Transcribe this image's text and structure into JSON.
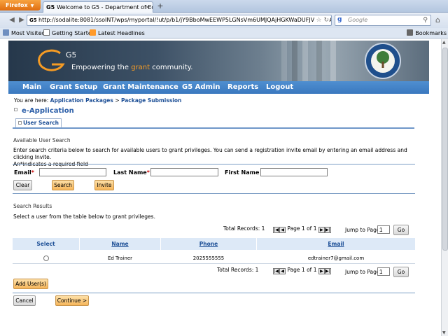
{
  "browser": {
    "app_button": "Firefox",
    "tab_title": "Welcome to G5 - Department of Educati...",
    "tab_favicon": "G5",
    "url": "http://sodalite:8081/ssoINT/wps/myportal/!ut/p/b1/jY9BboMwEEWP5LGNsVm6UMJQAjHGKWaDUFJVQSTpAkVK1",
    "search_placeholder": "Google",
    "bookmarks": {
      "most_visited": "Most Visited",
      "getting_started": "Getting Started",
      "latest_headlines": "Latest Headlines",
      "bookmarks": "Bookmarks"
    }
  },
  "banner": {
    "logo": "G5",
    "tagline_pre": "Empowering the ",
    "tagline_accent": "grant",
    "tagline_post": " community.",
    "accent_color": "#f59b24"
  },
  "menu": {
    "items": [
      "Main",
      "Grant Setup",
      "Grant Maintenance",
      "G5 Admin",
      "Reports",
      "Logout"
    ]
  },
  "breadcrumb": {
    "prefix": "You are here: ",
    "item1": "Application Packages",
    "sep": " > ",
    "item2": "Package Submission"
  },
  "app_title": "e-Application",
  "subtab": "User Search",
  "search": {
    "section_title": "Available User Search",
    "instructions_1": "Enter search criteria below to search for available users to grant privileges. You can send a registration invite email by entering an email address and clicking Invite.",
    "instructions_2": "An*indicates a required field",
    "email_label": "Email",
    "last_name_label": "Last Name",
    "first_name_label": "First Name",
    "required_mark": "*",
    "email_value": "",
    "last_name_value": "",
    "first_name_value": "",
    "clear_label": "Clear",
    "search_label": "Search",
    "invite_label": "Invite"
  },
  "results": {
    "section_title": "Search Results",
    "instructions": "Select a user from the table below to grant privileges.",
    "total_label": "Total Records: ",
    "total": "1",
    "page_text": "Page 1 of 1",
    "jump_label": "Jump to Page",
    "jump_value": "1",
    "go_label": "Go",
    "columns": [
      "Select",
      "Name",
      "Phone",
      "Email"
    ],
    "rows": [
      {
        "name": "Ed Trainer",
        "phone": "2025555555",
        "email": "edtrainer7@gmail.com"
      }
    ],
    "add_users_label": "Add User(s)"
  },
  "footer": {
    "cancel_label": "Cancel",
    "continue_label": "Continue >"
  }
}
